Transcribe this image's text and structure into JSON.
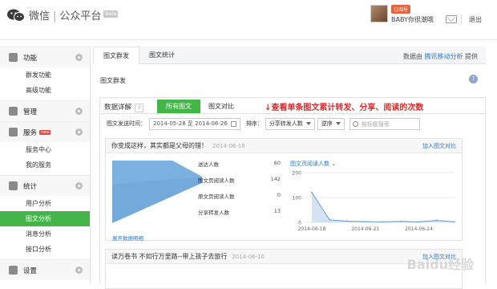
{
  "header": {
    "brand": "微信",
    "product": "公众平台",
    "beta": "Beta",
    "account_badge": "订阅号",
    "username": "BABY你很潮哦",
    "logout": "退出"
  },
  "sidebar": {
    "groups": [
      {
        "label": "功能",
        "icon": "function-icon",
        "new": "",
        "items": [
          "群发功能",
          "高级功能"
        ]
      },
      {
        "label": "管理",
        "icon": "manage-icon",
        "new": "",
        "items": []
      },
      {
        "label": "服务",
        "icon": "service-icon",
        "new": "new",
        "items": [
          "服务中心",
          "我的服务"
        ]
      },
      {
        "label": "统计",
        "icon": "stats-icon",
        "new": "",
        "items": [
          "用户分析",
          "图文分析",
          "消息分析",
          "接口分析"
        ]
      },
      {
        "label": "设置",
        "icon": "settings-icon",
        "new": "",
        "items": []
      }
    ],
    "active_item": "图文分析"
  },
  "main": {
    "tabs": [
      "图文群发",
      "图文统计"
    ],
    "provider_prefix": "数据由",
    "provider_name": "腾讯移动分析",
    "provider_suffix": "提供",
    "section_title": "图文群发",
    "help": "?"
  },
  "panel": {
    "title": "数据详解",
    "help": "?",
    "tabs": [
      "所有图文",
      "图文对比"
    ],
    "annotation": "↓查看单条图文累计转发、分享、阅读的次数",
    "filters": {
      "date_label": "图文发送时间：",
      "date_range": "2014-05-28 至 2014-06-26",
      "sort_label": "排序：",
      "sort_value": "分享转发人数",
      "order_value": "逆序",
      "search_placeholder": "按标题搜索"
    }
  },
  "articles": [
    {
      "title": "你变成这样，其实都是父母的错！",
      "date": "2014-06-18",
      "compare": "加入图文对比",
      "funnel": [
        {
          "label": "送达人数",
          "value": "60"
        },
        {
          "label": "图文页阅读人数",
          "value": "142"
        },
        {
          "label": "原文页阅读人数",
          "value": "0"
        },
        {
          "label": "分享转发人数",
          "value": "13"
        }
      ],
      "expand": "展开数据明细",
      "metric_select": "图文页阅读人数"
    },
    {
      "title": "读万卷书 不如行万里路--带上孩子去旅行",
      "date": "2014-06-10",
      "compare": "加入图文对比"
    }
  ],
  "chart_data": {
    "type": "area",
    "series": [
      {
        "name": "图文页阅读人数",
        "x": [
          "2014-06-18",
          "2014-06-19",
          "2014-06-20",
          "2014-06-21",
          "2014-06-22",
          "2014-06-23",
          "2014-06-24",
          "2014-06-25",
          "2014-06-26"
        ],
        "values": [
          120,
          10,
          5,
          3,
          2,
          4,
          2,
          8,
          2
        ]
      }
    ],
    "ylim": [
      0,
      200
    ],
    "yticks": [
      "200",
      "100",
      "0"
    ],
    "xticks": [
      "2014-06-18",
      "2014-06-21",
      "2014-06-24"
    ],
    "grid": true
  },
  "watermark": "Baidu经验",
  "colors": {
    "accent": "#44b549",
    "link": "#2b79d1",
    "annotation": "#e22a2a",
    "funnel": "#5b9bd5"
  }
}
